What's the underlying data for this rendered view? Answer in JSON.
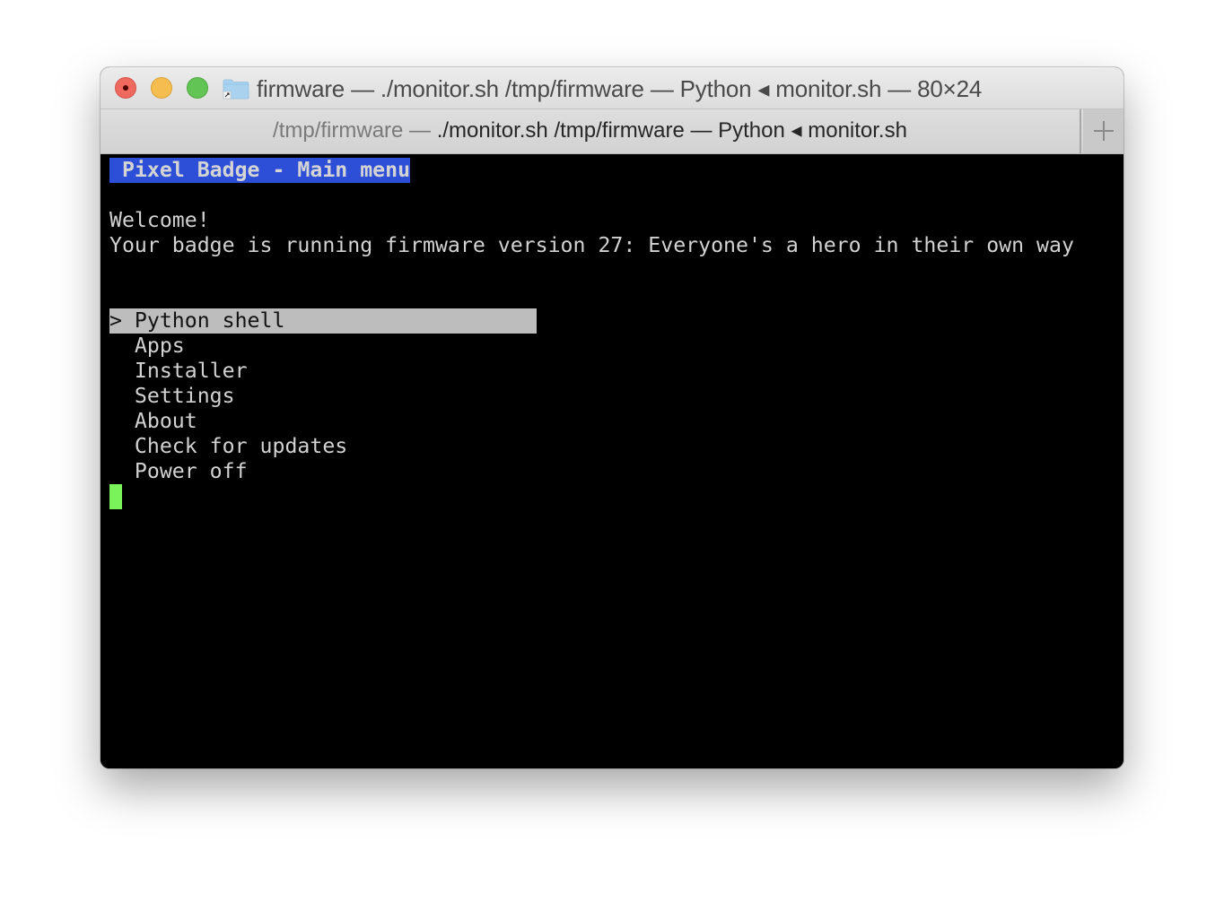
{
  "window": {
    "title": "firmware — ./monitor.sh /tmp/firmware — Python ◂ monitor.sh — 80×24",
    "folder_icon": "folder-alias-icon",
    "buttons": {
      "close": "close-window",
      "minimize": "minimize-window",
      "zoom": "zoom-window"
    }
  },
  "tabs": [
    {
      "muted_prefix": "/tmp/firmware — ",
      "label": "./monitor.sh /tmp/firmware — Python ◂ monitor.sh",
      "active": true
    }
  ],
  "new_tab": {
    "icon": "plus-icon",
    "label": "+"
  },
  "terminal": {
    "size": "80×24",
    "colors": {
      "background": "#000000",
      "foreground": "#d2d2d2",
      "header_bg": "#2d4fd8",
      "selection_bg": "#bdbdbd",
      "cursor": "#7af25a"
    },
    "header": " Pixel Badge - Main menu",
    "welcome": "Welcome!",
    "firmware_line": "Your badge is running firmware version 27: Everyone's a hero in their own way",
    "menu": {
      "pointer": "> ",
      "selected_index": 0,
      "items": [
        "Python shell",
        "Apps",
        "Installer",
        "Settings",
        "About",
        "Check for updates",
        "Power off"
      ]
    }
  }
}
